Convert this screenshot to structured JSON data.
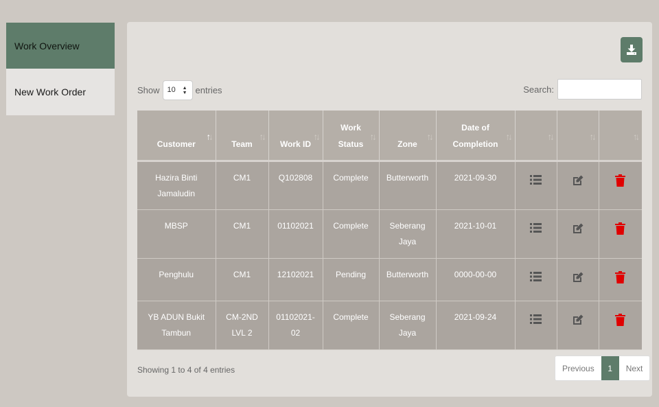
{
  "sidebar": {
    "items": [
      {
        "label": "Work Overview",
        "active": true
      },
      {
        "label": "New Work Order",
        "active": false
      }
    ]
  },
  "toolbar": {
    "download_icon": "download-icon"
  },
  "length": {
    "show": "Show",
    "value": "10",
    "entries": "entries"
  },
  "search": {
    "label": "Search:",
    "value": ""
  },
  "table": {
    "headers": [
      [
        "Customer"
      ],
      [
        "Team"
      ],
      [
        "Work ID"
      ],
      [
        "Work",
        "Status"
      ],
      [
        "Zone"
      ],
      [
        "Date of",
        "Completion"
      ],
      [
        ""
      ],
      [
        ""
      ],
      [
        ""
      ]
    ],
    "rows": [
      {
        "customer": [
          "Hazira Binti",
          "Jamaludin"
        ],
        "team": [
          "CM1"
        ],
        "work_id": [
          "Q102808"
        ],
        "status": "Complete",
        "zone": [
          "Butterworth"
        ],
        "date": "2021-09-30"
      },
      {
        "customer": [
          "MBSP"
        ],
        "team": [
          "CM1"
        ],
        "work_id": [
          "01102021"
        ],
        "status": "Complete",
        "zone": [
          "Seberang",
          "Jaya"
        ],
        "date": "2021-10-01"
      },
      {
        "customer": [
          "Penghulu"
        ],
        "team": [
          "CM1"
        ],
        "work_id": [
          "12102021"
        ],
        "status": "Pending",
        "zone": [
          "Butterworth"
        ],
        "date": "0000-00-00"
      },
      {
        "customer": [
          "YB ADUN Bukit",
          "Tambun"
        ],
        "team": [
          "CM-2ND",
          "LVL 2"
        ],
        "work_id": [
          "01102021-",
          "02"
        ],
        "status": "Complete",
        "zone": [
          "Seberang",
          "Jaya"
        ],
        "date": "2021-09-24"
      }
    ]
  },
  "footer": {
    "info": "Showing 1 to 4 of 4 entries"
  },
  "pagination": {
    "previous": "Previous",
    "current": "1",
    "next": "Next"
  },
  "colors": {
    "accent": "#5e7c6a",
    "delete": "#e00000",
    "header_bg": "#b5afa8",
    "row_bg": "#aba59f"
  }
}
